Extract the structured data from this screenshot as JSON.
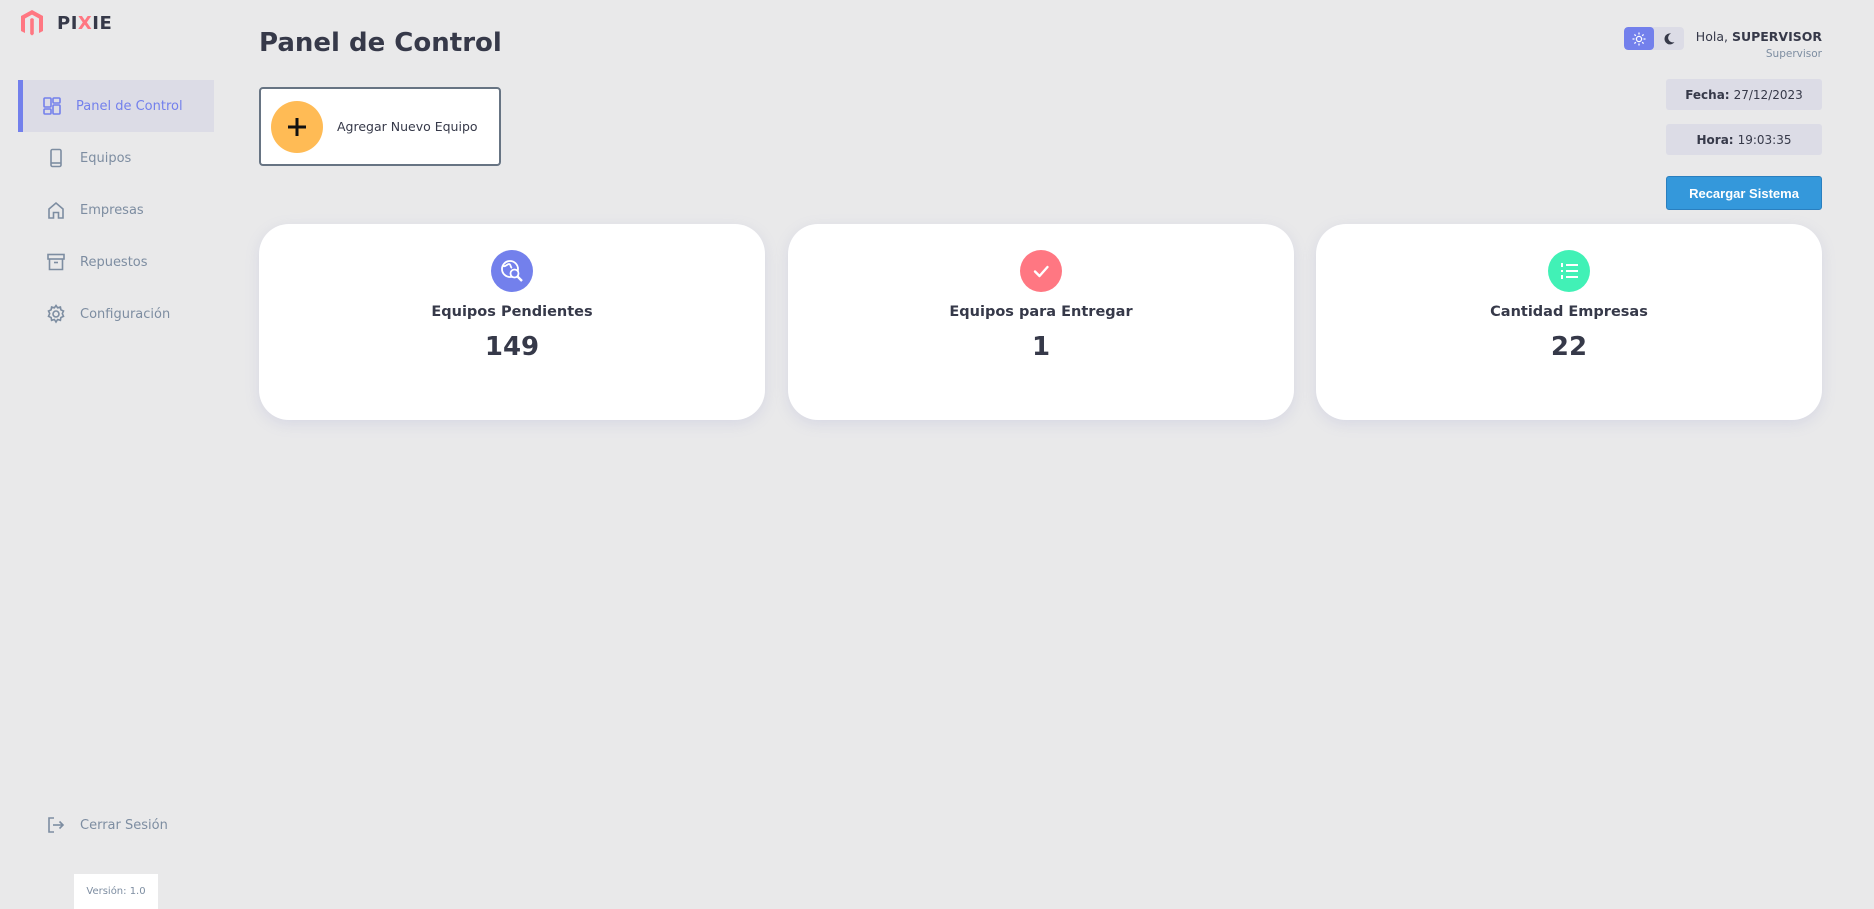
{
  "brand": {
    "prefix": "PI",
    "highlight": "X",
    "suffix": "IE"
  },
  "sidebar": {
    "items": [
      {
        "label": "Panel de Control",
        "icon": "dashboard-icon",
        "active": true
      },
      {
        "label": "Equipos",
        "icon": "phone-icon"
      },
      {
        "label": "Empresas",
        "icon": "home-icon"
      },
      {
        "label": "Repuestos",
        "icon": "archive-icon"
      },
      {
        "label": "Configuración",
        "icon": "gear-icon"
      }
    ],
    "logout_label": "Cerrar Sesión",
    "version": "Versión: 1.0"
  },
  "header": {
    "title": "Panel de Control",
    "greeting_prefix": "Hola,",
    "user_name": "SUPERVISOR",
    "user_role": "Supervisor",
    "date_label": "Fecha:",
    "date_value": "27/12/2023",
    "time_label": "Hora:",
    "time_value": "19:03:35",
    "reload_label": "Recargar Sistema"
  },
  "actions": {
    "add_equipment_label": "Agregar Nuevo Equipo"
  },
  "cards": [
    {
      "title": "Equipos Pendientes",
      "value": "149",
      "color": "#7380ec",
      "icon": "search-globe-icon"
    },
    {
      "title": "Equipos para Entregar",
      "value": "1",
      "color": "#ff7782",
      "icon": "check-icon"
    },
    {
      "title": "Cantidad Empresas",
      "value": "22",
      "color": "#41f1b6",
      "icon": "list-icon"
    }
  ],
  "colors": {
    "primary": "#7380ec",
    "danger": "#ff7782",
    "success": "#41f1b6",
    "warning": "#ffbb55",
    "reload": "#3498db"
  }
}
